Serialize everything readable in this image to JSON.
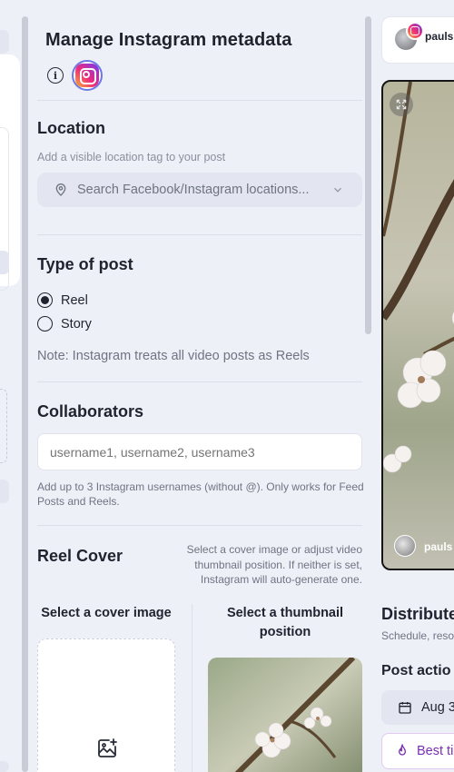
{
  "panel": {
    "title": "Manage Instagram metadata",
    "info_icon": "info-icon",
    "platform_icon": "instagram-icon"
  },
  "location": {
    "heading": "Location",
    "help": "Add a visible location tag to your post",
    "placeholder": "Search Facebook/Instagram locations..."
  },
  "post_type": {
    "heading": "Type of post",
    "options": [
      {
        "label": "Reel",
        "selected": true
      },
      {
        "label": "Story",
        "selected": false
      }
    ],
    "note": "Note: Instagram treats all video posts as Reels"
  },
  "collaborators": {
    "heading": "Collaborators",
    "placeholder": "username1, username2, username3",
    "help": "Add up to 3 Instagram usernames (without @). Only works for Feed Posts and Reels."
  },
  "reel_cover": {
    "heading": "Reel Cover",
    "help": "Select a cover image or adjust video thumbnail position. If neither is set, Instagram will auto-generate one.",
    "cover_label": "Select a cover image",
    "thumbnail_label": "Select a thumbnail position"
  },
  "preview": {
    "handle": "pauls",
    "overlay_handle": "pauls"
  },
  "distribute": {
    "title": "Distribute",
    "subtitle": "Schedule, reso",
    "post_actions": "Post actio",
    "date": "Aug 3",
    "best_time": "Best ti"
  },
  "colors": {
    "accent": "#6c78e8",
    "muted_text": "#6f7483",
    "field_bg": "#e3e6f0",
    "best_time": "#7b2fb3"
  }
}
